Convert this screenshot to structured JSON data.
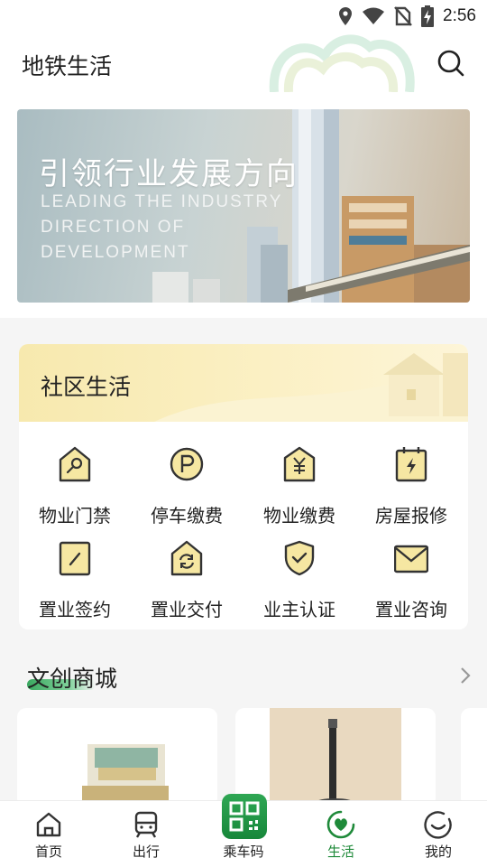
{
  "status_bar": {
    "time": "2:56",
    "icons": [
      "location-icon",
      "wifi-icon",
      "no-sim-icon",
      "battery-charging-icon"
    ]
  },
  "header": {
    "title": "地铁生活",
    "search_icon": "search-icon"
  },
  "banner": {
    "title_cn": "引领行业发展方向",
    "title_en_lines": [
      "LEADING THE INDUSTRY",
      "DIRECTION OF",
      "DEVELOPMENT"
    ]
  },
  "community": {
    "title": "社区生活",
    "items": [
      {
        "label": "物业门禁",
        "icon": "property-key-icon"
      },
      {
        "label": "停车缴费",
        "icon": "parking-icon"
      },
      {
        "label": "物业缴费",
        "icon": "property-fee-icon"
      },
      {
        "label": "房屋报修",
        "icon": "house-repair-icon"
      },
      {
        "label": "置业签约",
        "icon": "sign-contract-icon"
      },
      {
        "label": "置业交付",
        "icon": "property-delivery-icon"
      },
      {
        "label": "业主认证",
        "icon": "owner-verify-icon"
      },
      {
        "label": "置业咨询",
        "icon": "consult-mail-icon"
      }
    ]
  },
  "shop": {
    "title": "文创商城",
    "more_icon": "chevron-right-icon"
  },
  "tabbar": {
    "tabs": [
      {
        "label": "首页",
        "icon": "home-icon"
      },
      {
        "label": "出行",
        "icon": "metro-icon"
      },
      {
        "label": "乘车码",
        "icon": "qr-code-icon"
      },
      {
        "label": "生活",
        "icon": "life-heart-icon",
        "active": true
      },
      {
        "label": "我的",
        "icon": "profile-smile-icon"
      }
    ]
  },
  "colors": {
    "accent_green": "#1f8a3a",
    "community_yellow": "#f7e9ae",
    "icon_fill": "#f6e7a2"
  }
}
